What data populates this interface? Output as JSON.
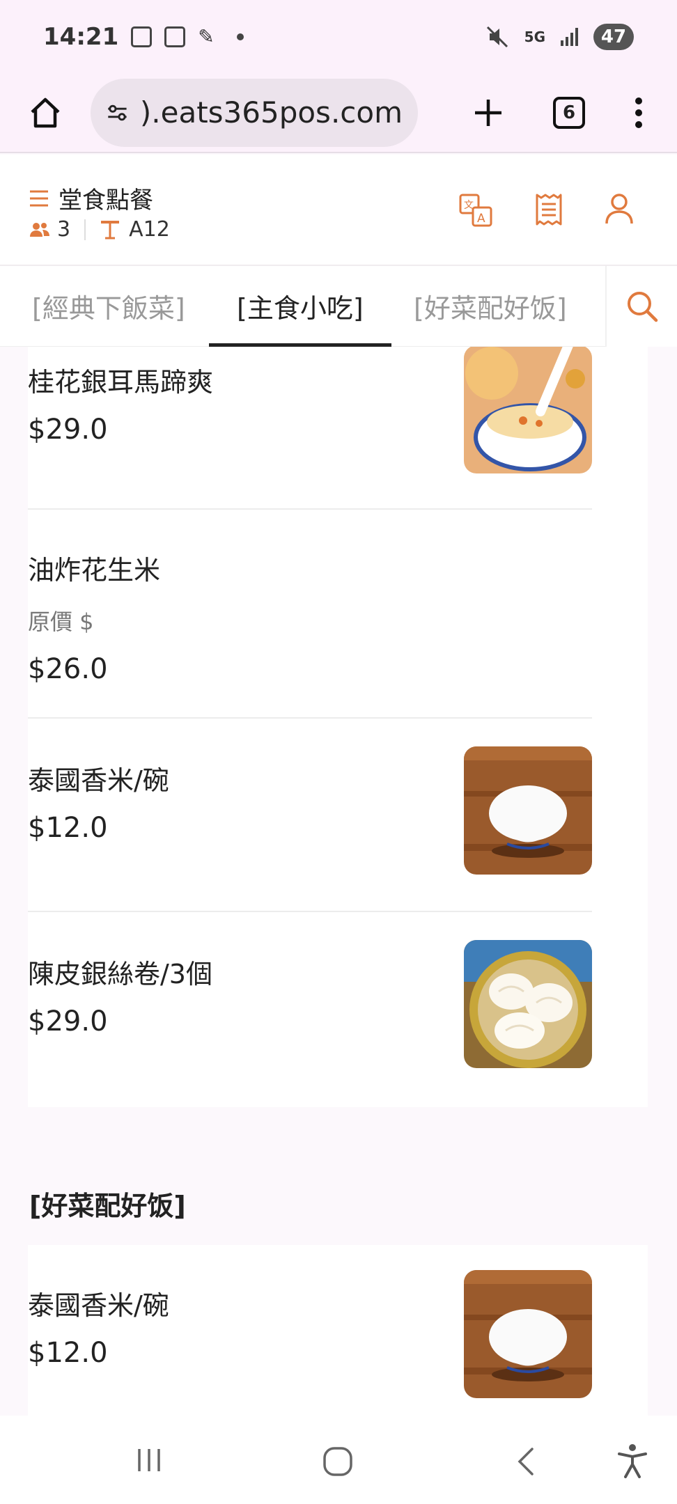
{
  "status_bar": {
    "time": "14:21",
    "network": "5G",
    "battery": "47"
  },
  "browser": {
    "url": ").eats365pos.com",
    "tab_count": "6"
  },
  "app_header": {
    "title": "堂食點餐",
    "guests": "3",
    "table": "A12"
  },
  "tabs": [
    {
      "label": "[經典下飯菜]"
    },
    {
      "label": "[主食小吃]"
    },
    {
      "label": "[好菜配好饭]"
    }
  ],
  "menu_items": [
    {
      "name": "桂花銀耳馬蹄爽",
      "price": "$29.0"
    },
    {
      "name": "油炸花生米",
      "original_price": "原價 $",
      "price": "$26.0"
    },
    {
      "name": "泰國香米/碗",
      "price": "$12.0"
    },
    {
      "name": "陳皮銀絲卷/3個",
      "price": "$29.0"
    }
  ],
  "section": {
    "title": "[好菜配好饭]",
    "items": [
      {
        "name": "泰國香米/碗",
        "price": "$12.0"
      }
    ]
  },
  "colors": {
    "accent": "#e07a3e",
    "background": "#fcf8fc"
  }
}
